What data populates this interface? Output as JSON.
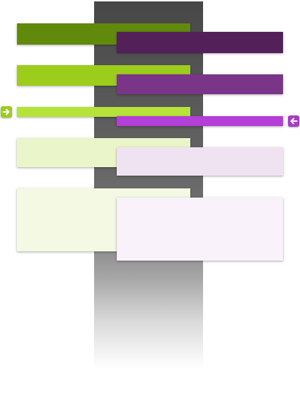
{
  "colors": {
    "green_dark": "#618a0c",
    "green_mid": "#9ccc1c",
    "green_bright": "#b5e33a",
    "green_pale": "#eaf6c9",
    "green_faint": "#f3f9e2",
    "purple_dark": "#53205a",
    "purple_mid": "#7a3488",
    "purple_bright": "#b43ed8",
    "purple_pale": "#f0e3f1",
    "purple_faint": "#f9f2fb"
  },
  "icons": {
    "left_arrow_button": "arrow-right-icon",
    "right_arrow_button": "arrow-left-icon"
  }
}
